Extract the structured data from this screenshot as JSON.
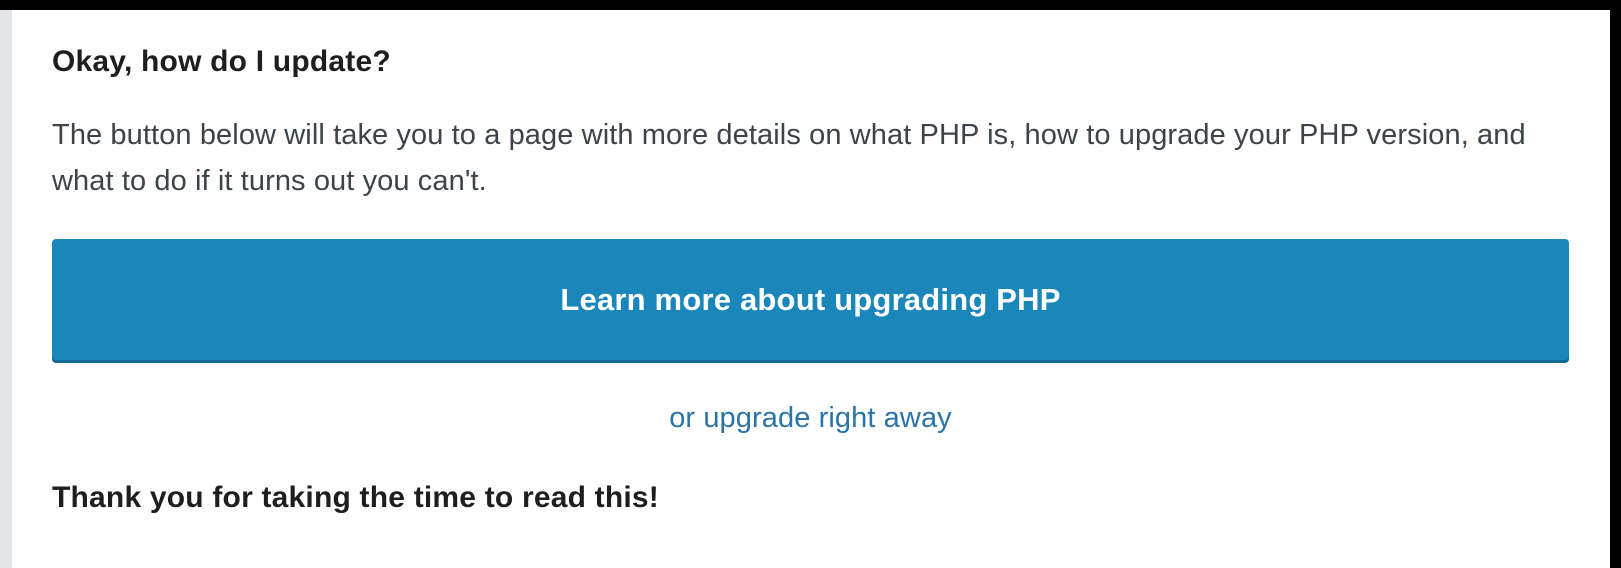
{
  "notice": {
    "heading": "Okay, how do I update?",
    "description": "The button below will take you to a page with more details on what PHP is, how to upgrade your PHP version, and what to do if it turns out you can't.",
    "button_label": "Learn more about upgrading PHP",
    "alt_link": "or upgrade right away",
    "thanks": "Thank you for taking the time to read this!"
  },
  "colors": {
    "button_background": "#1a86ba",
    "link": "#2a74a8",
    "text": "#1e1e1e",
    "panel_border": "#e2e4e7"
  }
}
